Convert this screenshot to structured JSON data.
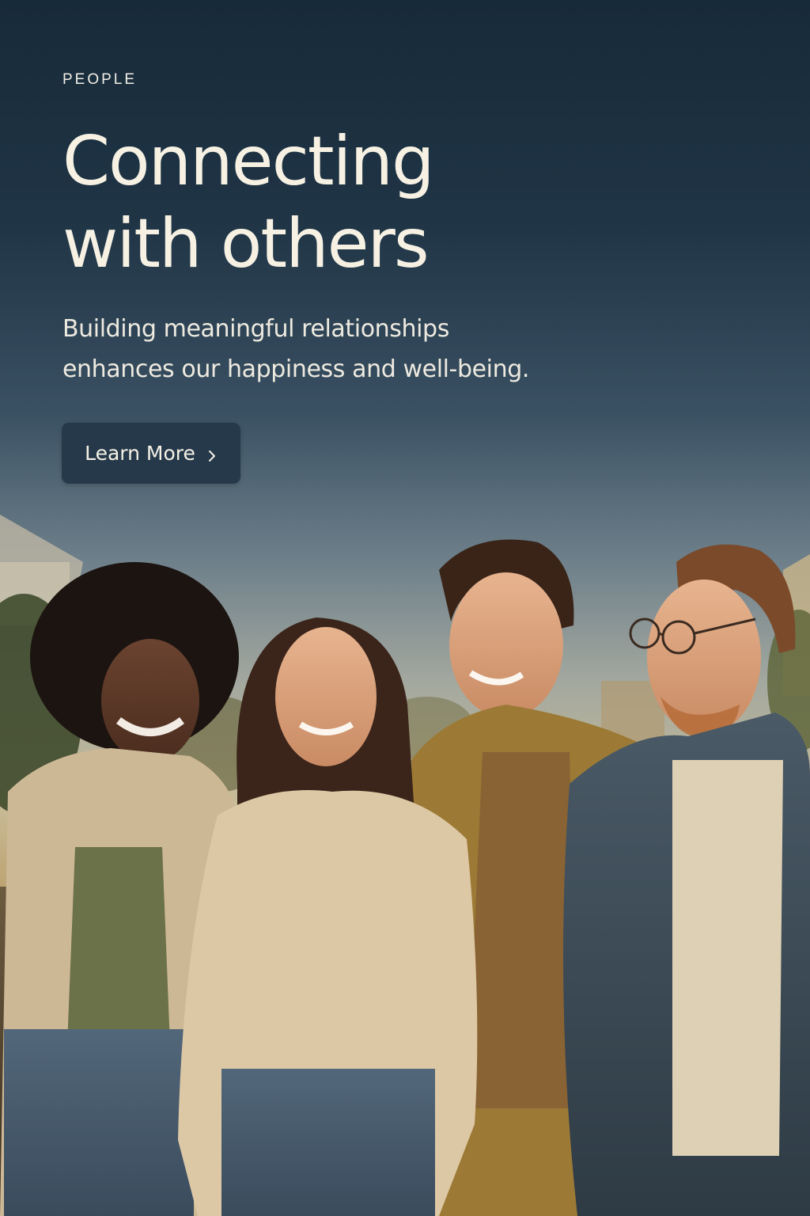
{
  "hero": {
    "eyebrow": "PEOPLE",
    "headline_line1": "Connecting",
    "headline_line2": "with others",
    "subtitle_line1": "Building meaningful relationships",
    "subtitle_line2": "enhances our happiness and well-being.",
    "cta_label": "Learn More",
    "cta_icon": "chevron-right-icon"
  },
  "colors": {
    "sky_top": "#172a39",
    "button_bg": "#26394a",
    "headline_text": "#f6f1e3"
  },
  "photo": {
    "subject": "four smiling friends walking outdoors at sunset"
  }
}
